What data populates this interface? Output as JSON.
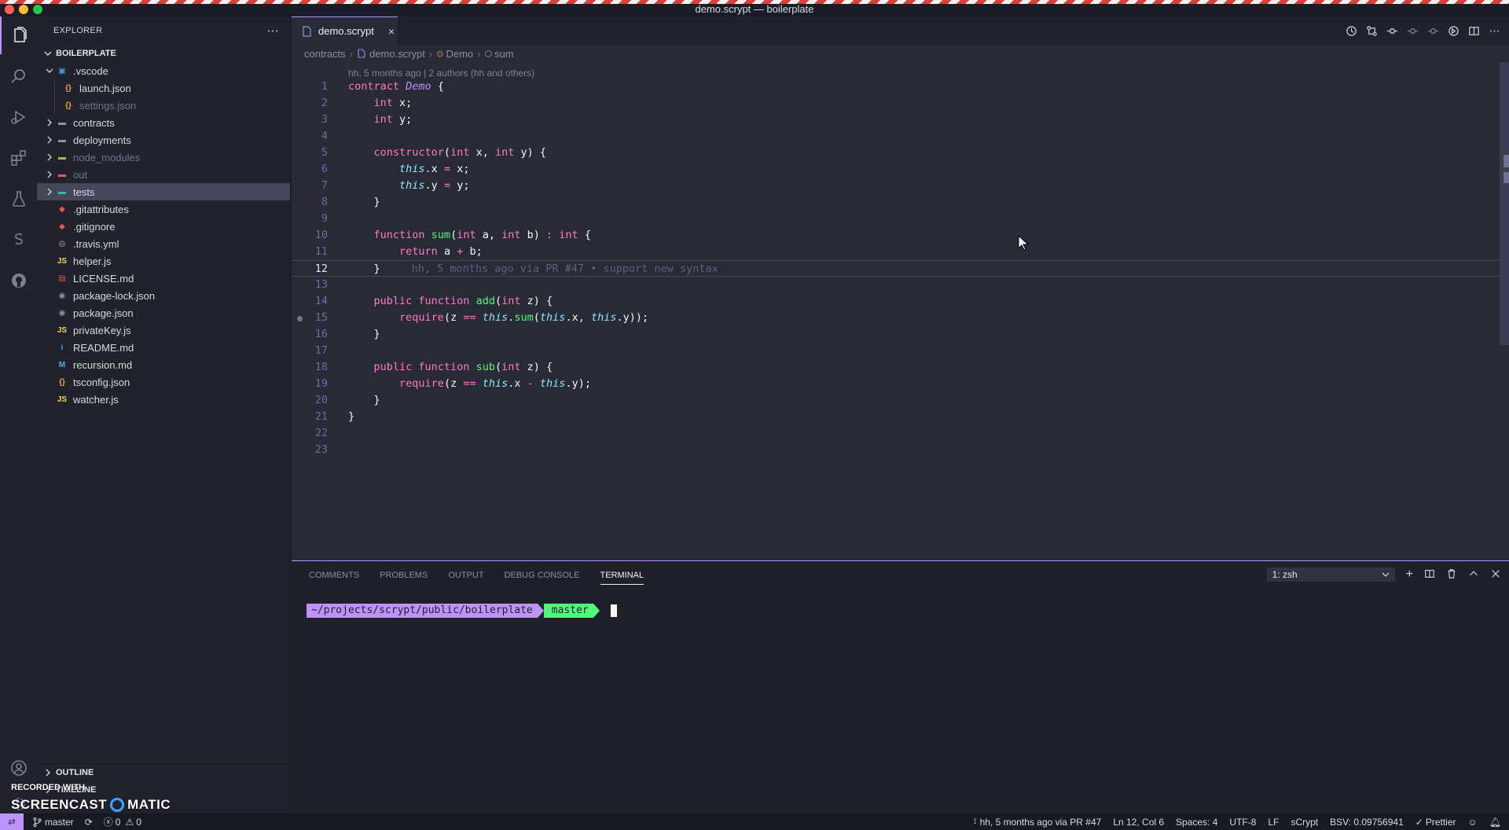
{
  "window": {
    "title": "demo.scrypt — boilerplate"
  },
  "explorer": {
    "header": "EXPLORER",
    "section": "BOILERPLATE",
    "tree": [
      {
        "label": ".vscode",
        "kind": "folder",
        "depth": 0,
        "open": true,
        "icon": "vscode-folder-icon"
      },
      {
        "label": "launch.json",
        "kind": "file",
        "depth": 1,
        "icon": "json-icon"
      },
      {
        "label": "settings.json",
        "kind": "file",
        "depth": 1,
        "icon": "json-icon",
        "dimmed": true
      },
      {
        "label": "contracts",
        "kind": "folder",
        "depth": 0,
        "icon": "folder-icon"
      },
      {
        "label": "deployments",
        "kind": "folder",
        "depth": 0,
        "icon": "folder-icon"
      },
      {
        "label": "node_modules",
        "kind": "folder",
        "depth": 0,
        "icon": "node-folder-icon",
        "dimmed": true
      },
      {
        "label": "out",
        "kind": "folder",
        "depth": 0,
        "icon": "out-folder-icon",
        "dimmed": true
      },
      {
        "label": "tests",
        "kind": "folder",
        "depth": 0,
        "icon": "tests-folder-icon",
        "selected": true
      },
      {
        "label": ".gitattributes",
        "kind": "file",
        "depth": 0,
        "icon": "git-icon"
      },
      {
        "label": ".gitignore",
        "kind": "file",
        "depth": 0,
        "icon": "git-icon"
      },
      {
        "label": ".travis.yml",
        "kind": "file",
        "depth": 0,
        "icon": "travis-icon"
      },
      {
        "label": "helper.js",
        "kind": "file",
        "depth": 0,
        "icon": "js-icon"
      },
      {
        "label": "LICENSE.md",
        "kind": "file",
        "depth": 0,
        "icon": "license-icon"
      },
      {
        "label": "package-lock.json",
        "kind": "file",
        "depth": 0,
        "icon": "npm-icon"
      },
      {
        "label": "package.json",
        "kind": "file",
        "depth": 0,
        "icon": "npm-icon"
      },
      {
        "label": "privateKey.js",
        "kind": "file",
        "depth": 0,
        "icon": "js-icon"
      },
      {
        "label": "README.md",
        "kind": "file",
        "depth": 0,
        "icon": "info-icon"
      },
      {
        "label": "recursion.md",
        "kind": "file",
        "depth": 0,
        "icon": "markdown-icon"
      },
      {
        "label": "tsconfig.json",
        "kind": "file",
        "depth": 0,
        "icon": "json-icon"
      },
      {
        "label": "watcher.js",
        "kind": "file",
        "depth": 0,
        "icon": "js-icon"
      }
    ],
    "outline_label": "OUTLINE",
    "timeline_label": "TIMELINE"
  },
  "editor": {
    "tab_label": "demo.scrypt",
    "tab_close": "×",
    "breadcrumb": [
      "contracts",
      "demo.scrypt",
      "Demo",
      "sum"
    ],
    "codelens": "hh, 5 months ago | 2 authors (hh and others)",
    "current_line": 12,
    "blame_annotation": "hh, 5 months ago via PR #47 • support new syntax",
    "lines": [
      [
        [
          "k",
          "contract "
        ],
        [
          "t",
          "Demo"
        ],
        [
          "p",
          " {"
        ]
      ],
      [
        [
          "p",
          "    "
        ],
        [
          "k",
          "int"
        ],
        [
          "p",
          " x;"
        ]
      ],
      [
        [
          "p",
          "    "
        ],
        [
          "k",
          "int"
        ],
        [
          "p",
          " y;"
        ]
      ],
      [],
      [
        [
          "p",
          "    "
        ],
        [
          "k",
          "constructor"
        ],
        [
          "p",
          "("
        ],
        [
          "k",
          "int"
        ],
        [
          "p",
          " x, "
        ],
        [
          "k",
          "int"
        ],
        [
          "p",
          " y) {"
        ]
      ],
      [
        [
          "p",
          "        "
        ],
        [
          "c",
          "this"
        ],
        [
          "p",
          ".x "
        ],
        [
          "k",
          "="
        ],
        [
          "p",
          " x;"
        ]
      ],
      [
        [
          "p",
          "        "
        ],
        [
          "c",
          "this"
        ],
        [
          "p",
          ".y "
        ],
        [
          "k",
          "="
        ],
        [
          "p",
          " y;"
        ]
      ],
      [
        [
          "p",
          "    }"
        ]
      ],
      [],
      [
        [
          "p",
          "    "
        ],
        [
          "k",
          "function "
        ],
        [
          "f",
          "sum"
        ],
        [
          "p",
          "("
        ],
        [
          "k",
          "int"
        ],
        [
          "p",
          " a, "
        ],
        [
          "k",
          "int"
        ],
        [
          "p",
          " b) "
        ],
        [
          "k",
          ":"
        ],
        [
          "p",
          " "
        ],
        [
          "k",
          "int"
        ],
        [
          "p",
          " {"
        ]
      ],
      [
        [
          "p",
          "        "
        ],
        [
          "k",
          "return"
        ],
        [
          "p",
          " a "
        ],
        [
          "k",
          "+"
        ],
        [
          "p",
          " b;"
        ]
      ],
      [
        [
          "p",
          "    }"
        ]
      ],
      [],
      [
        [
          "p",
          "    "
        ],
        [
          "k",
          "public function "
        ],
        [
          "f",
          "add"
        ],
        [
          "p",
          "("
        ],
        [
          "k",
          "int"
        ],
        [
          "p",
          " z) {"
        ]
      ],
      [
        [
          "p",
          "        "
        ],
        [
          "k",
          "require"
        ],
        [
          "p",
          "(z "
        ],
        [
          "k",
          "=="
        ],
        [
          "p",
          " "
        ],
        [
          "c",
          "this"
        ],
        [
          "p",
          "."
        ],
        [
          "f",
          "sum"
        ],
        [
          "p",
          "("
        ],
        [
          "c",
          "this"
        ],
        [
          "p",
          ".x, "
        ],
        [
          "c",
          "this"
        ],
        [
          "p",
          ".y));"
        ]
      ],
      [
        [
          "p",
          "    }"
        ]
      ],
      [],
      [
        [
          "p",
          "    "
        ],
        [
          "k",
          "public function "
        ],
        [
          "f",
          "sub"
        ],
        [
          "p",
          "("
        ],
        [
          "k",
          "int"
        ],
        [
          "p",
          " z) {"
        ]
      ],
      [
        [
          "p",
          "        "
        ],
        [
          "k",
          "require"
        ],
        [
          "p",
          "(z "
        ],
        [
          "k",
          "=="
        ],
        [
          "p",
          " "
        ],
        [
          "c",
          "this"
        ],
        [
          "p",
          ".x "
        ],
        [
          "k",
          "-"
        ],
        [
          "p",
          " "
        ],
        [
          "c",
          "this"
        ],
        [
          "p",
          ".y);"
        ]
      ],
      [
        [
          "p",
          "    }"
        ]
      ],
      [
        [
          "p",
          "}"
        ]
      ],
      [],
      []
    ]
  },
  "panel": {
    "tabs": [
      "COMMENTS",
      "PROBLEMS",
      "OUTPUT",
      "DEBUG CONSOLE",
      "TERMINAL"
    ],
    "active_tab": "TERMINAL",
    "terminal_select": "1: zsh",
    "prompt_path": "~/projects/scrypt/public/boilerplate",
    "prompt_branch": " master"
  },
  "statusbar": {
    "branch": "master",
    "errors": "0",
    "warnings": "0",
    "blame": "hh, 5 months ago via PR #47",
    "cursor": "Ln 12, Col 6",
    "spaces": "Spaces: 4",
    "encoding": "UTF-8",
    "eol": "LF",
    "language": "sCrypt",
    "bsv": "BSV: 0.09756941",
    "formatter": "Prettier"
  },
  "watermark": {
    "line1": "RECORDED WITH",
    "brand_left": "SCREENCAST",
    "brand_right": "MATIC"
  },
  "colors": {
    "accent": "#bd93f9",
    "green": "#50fa7b",
    "pink": "#ff79c6",
    "cyan": "#8be9fd",
    "background": "#282a36"
  }
}
